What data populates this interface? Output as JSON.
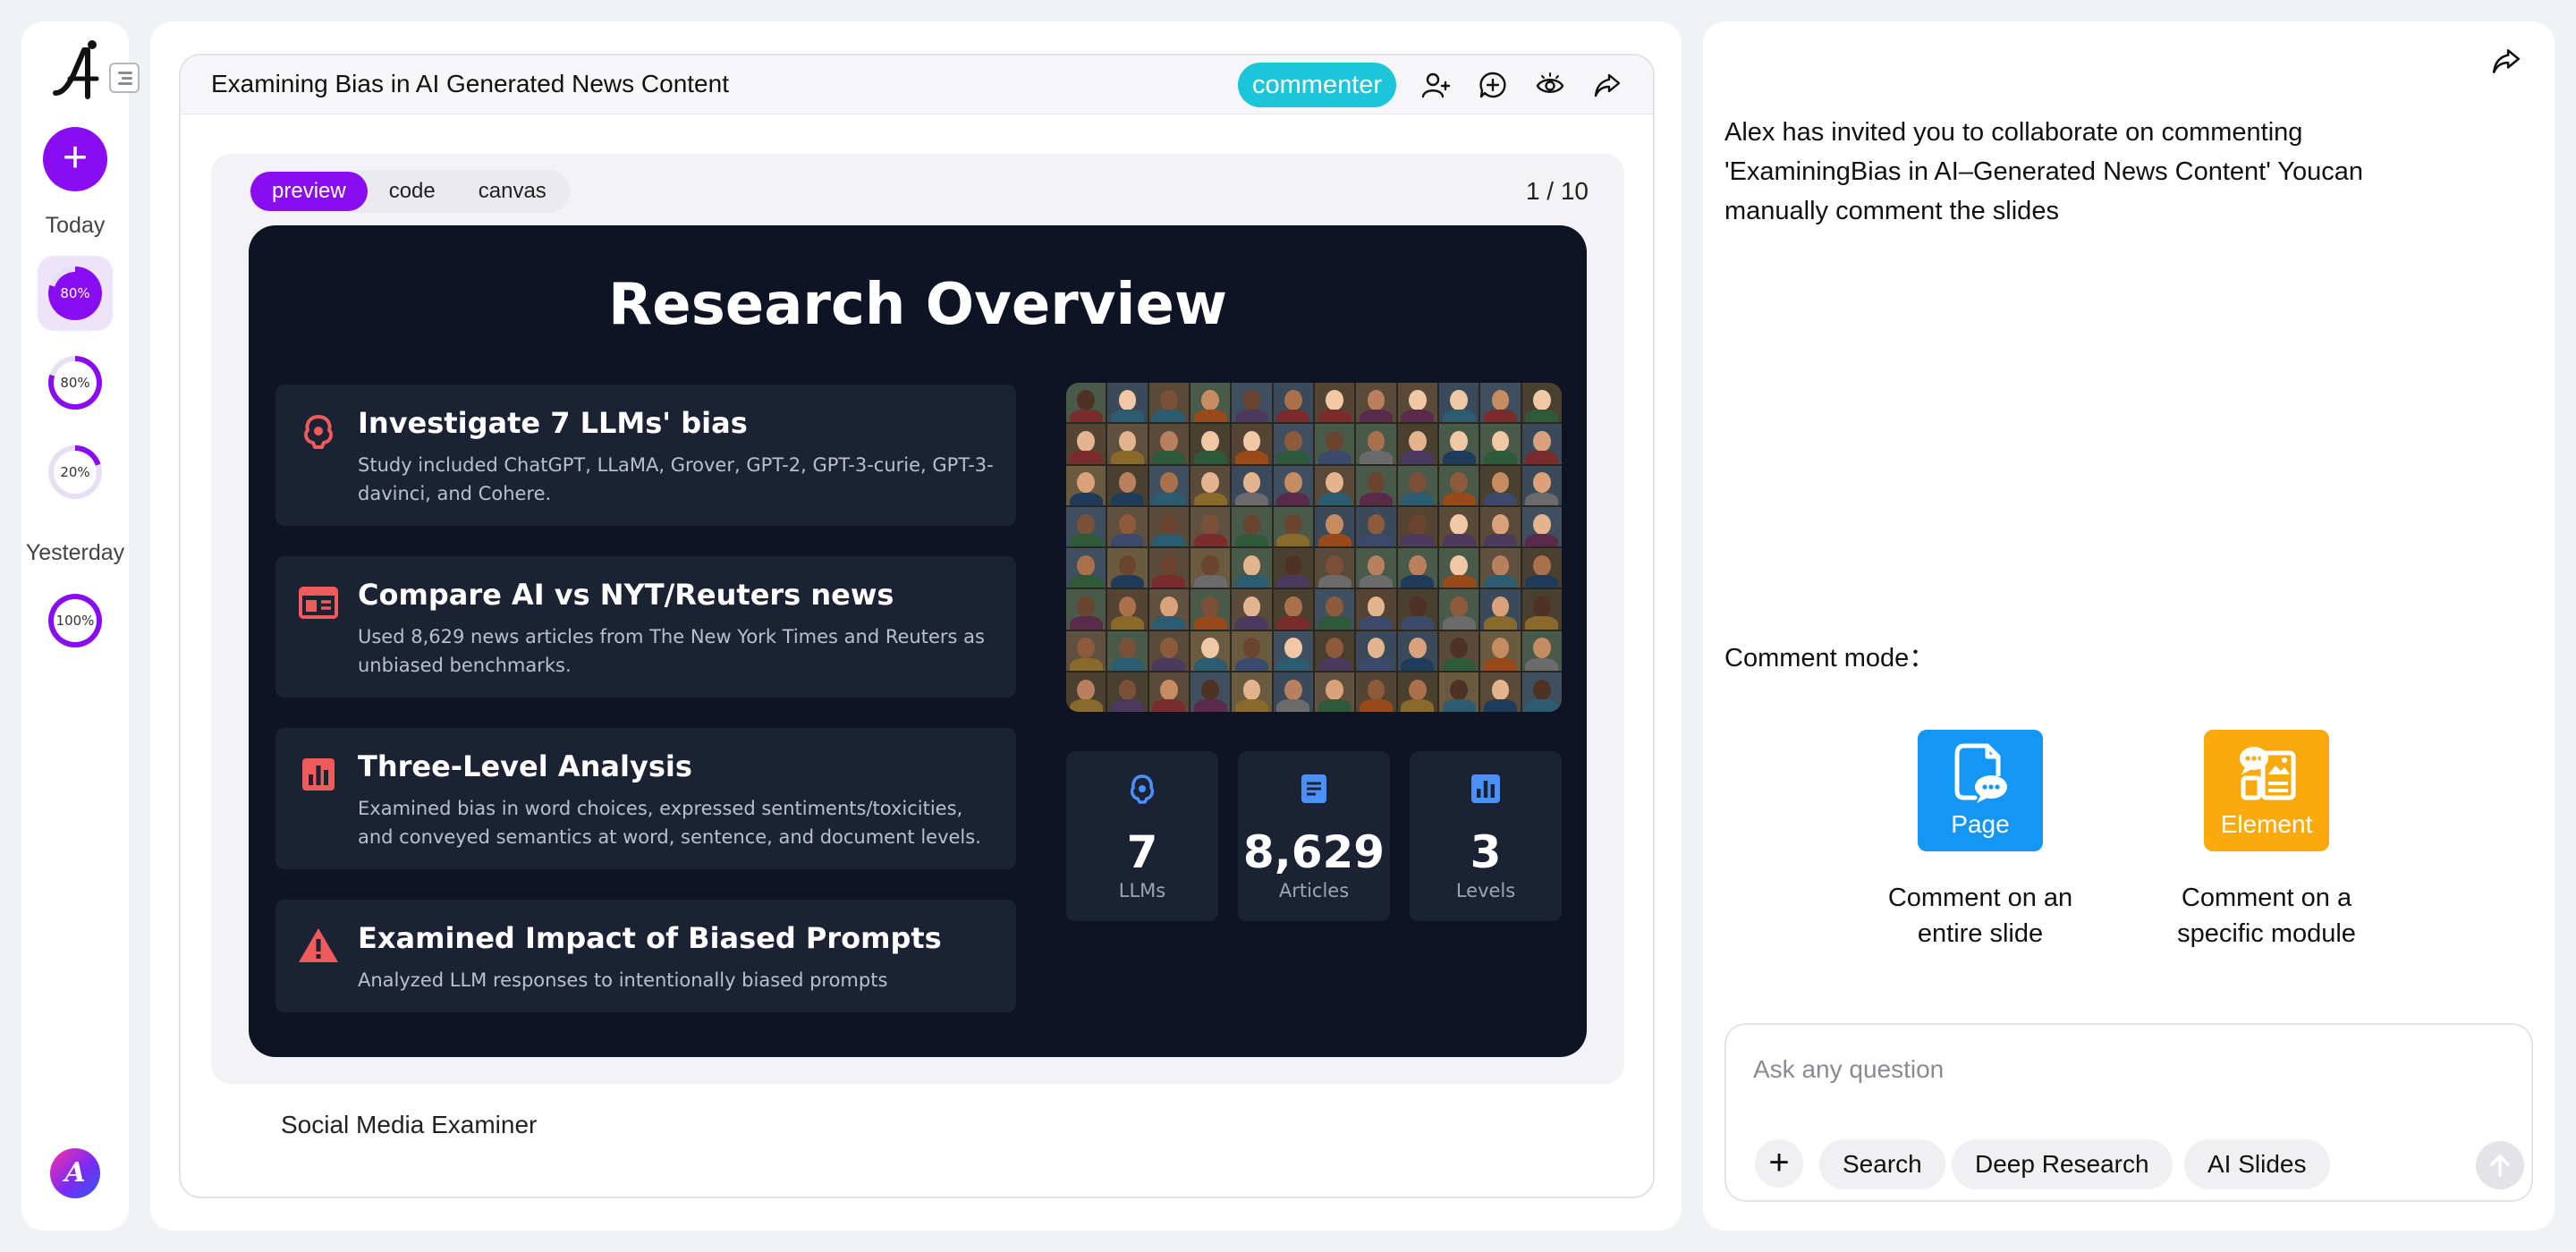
{
  "rail": {
    "groups": [
      {
        "label": "Today"
      },
      {
        "label": "Yesterday"
      }
    ],
    "chats": [
      {
        "progress_label": "80%",
        "progress": 0.8
      },
      {
        "progress_label": "80%",
        "progress": 0.8
      },
      {
        "progress_label": "20%",
        "progress": 0.2
      },
      {
        "progress_label": "100%",
        "progress": 1.0
      }
    ],
    "new_chat_icon": "plus-icon",
    "profile_initial": "A"
  },
  "doc": {
    "title": "Examining Bias in AI Generated News Content",
    "role_badge": "commenter",
    "header_icons": [
      "add-user-icon",
      "add-comment-icon",
      "preview-eye-icon",
      "share-icon"
    ],
    "tabs": [
      "preview",
      "code",
      "canvas"
    ],
    "active_tab": "preview",
    "page_count": "1 / 10",
    "caption": "Social Media Examiner"
  },
  "slide": {
    "title": "Research Overview",
    "cards": [
      {
        "icon": "brain-icon",
        "title": "Investigate 7 LLMs' bias",
        "desc": "Study included ChatGPT, LLaMA, Grover, GPT-2, GPT-3-curie, GPT-3-davinci, and Cohere."
      },
      {
        "icon": "newspaper-icon",
        "title": "Compare AI vs NYT/Reuters news",
        "desc": "Used 8,629 news articles from The New York Times and Reuters as unbiased benchmarks."
      },
      {
        "icon": "bar-chart-icon",
        "title": "Three-Level Analysis",
        "desc": "Examined bias in word choices, expressed sentiments/toxicities, and conveyed semantics at word, sentence, and document levels."
      },
      {
        "icon": "warning-icon",
        "title": "Examined Impact of Biased Prompts",
        "desc": "Analyzed LLM responses to intentionally biased prompts"
      }
    ],
    "stats": [
      {
        "icon": "brain-icon",
        "value": "7",
        "label": "LLMs"
      },
      {
        "icon": "document-icon",
        "value": "8,629",
        "label": "Articles"
      },
      {
        "icon": "bar-chart-icon",
        "value": "3",
        "label": "Levels"
      }
    ]
  },
  "right": {
    "invite_text": "Alex has invited you to collaborate on commenting 'ExaminingBias in AI–Generated News Content' Youcan manually comment the slides",
    "mode_label": "Comment mode：",
    "modes": [
      {
        "tile": "Page",
        "desc": "Comment on an entire slide",
        "color": "#1496f5"
      },
      {
        "tile": "Element",
        "desc": "Comment on a specific module",
        "color": "#fbaa0d"
      }
    ],
    "chat_placeholder": "Ask any question",
    "chips": [
      "Search",
      "Deep Research",
      "AI Slides"
    ]
  },
  "colors": {
    "accent": "#8a0cf0",
    "badge": "#1cc5d9",
    "slide_bg": "#0e1424",
    "card_bg": "#1b2233",
    "red_icon": "#ef5a5a",
    "blue_icon": "#4a90ff"
  }
}
